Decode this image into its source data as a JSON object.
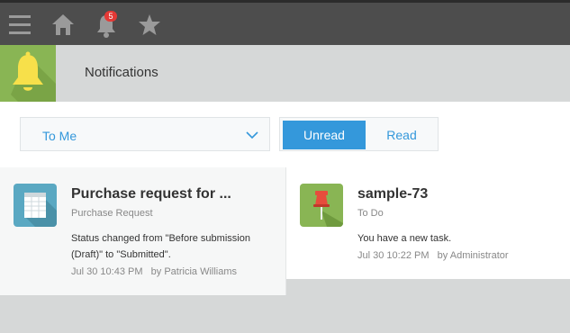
{
  "topbar": {
    "notification_count": "5",
    "icons": [
      "menu-icon",
      "home-icon",
      "bell-icon",
      "star-icon"
    ]
  },
  "header": {
    "title": "Notifications",
    "icon": "bell-icon"
  },
  "filters": {
    "recipient_selected": "To Me",
    "unread_label": "Unread",
    "read_label": "Read"
  },
  "notifications": [
    {
      "title": "Purchase request for ...",
      "app": "Purchase Request",
      "message": "Status changed from \"Before submission (Draft)\" to \"Submitted\".",
      "time": "Jul 30 10:43 PM",
      "by": "by Patricia Williams",
      "icon": "spreadsheet-icon"
    },
    {
      "title": "sample-73",
      "app": "To Do",
      "message": "You have a new task.",
      "time": "Jul 30 10:22 PM",
      "by": "by Administrator",
      "icon": "pin-icon"
    }
  ],
  "colors": {
    "accent": "#3498db",
    "topbar": "#4d4d4d",
    "badge": "#e53935",
    "bell_tile": "#89b554"
  }
}
